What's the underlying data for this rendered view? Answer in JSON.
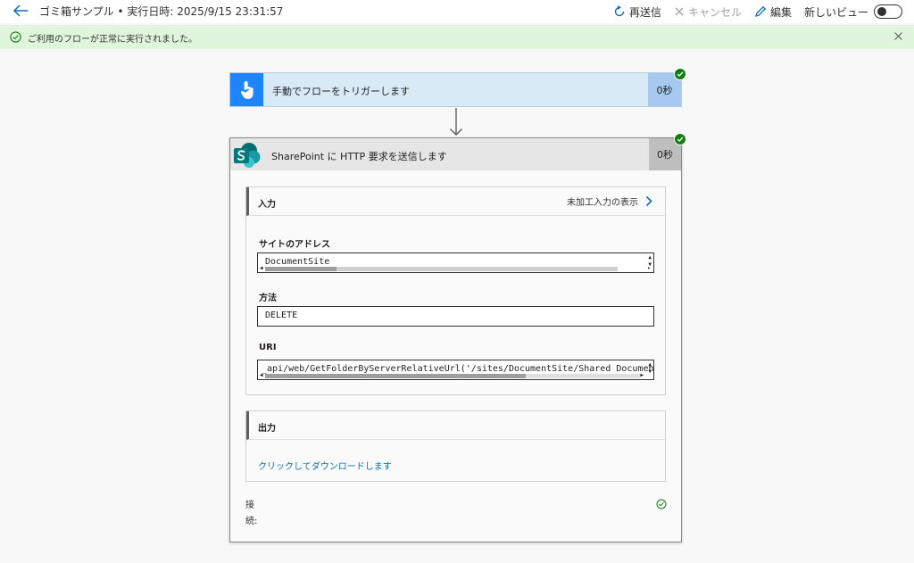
{
  "header": {
    "title": "ゴミ箱サンプル • 実行日時: 2025/9/15 23:31:57",
    "resubmit_label": "再送信",
    "cancel_label": "キャンセル",
    "edit_label": "編集",
    "new_view_label": "新しいビュー",
    "new_view_enabled": false
  },
  "banner": {
    "message": "ご利用のフローが正常に実行されました。",
    "color": "#dff6dd"
  },
  "trigger": {
    "label": "手動でフローをトリガーします",
    "duration": "0秒",
    "icon": "hand-pointer-icon",
    "status": "succeeded"
  },
  "action": {
    "label": "SharePoint に HTTP 要求を送信します",
    "duration": "0秒",
    "icon": "sharepoint-icon",
    "status": "succeeded",
    "inputs": {
      "title": "入力",
      "raw_inputs_label": "未加工入力の表示",
      "site_address_label": "サイトのアドレス",
      "site_address_value": "DocumentSite",
      "method_label": "方法",
      "method_value": "DELETE",
      "uri_label": "URI",
      "uri_value": "_api/web/GetFolderByServerRelativeUrl('/sites/DocumentSite/Shared Documents')"
    },
    "outputs": {
      "title": "出力",
      "download_label": "クリックしてダウンロードします"
    },
    "connection_label": "接続:"
  }
}
